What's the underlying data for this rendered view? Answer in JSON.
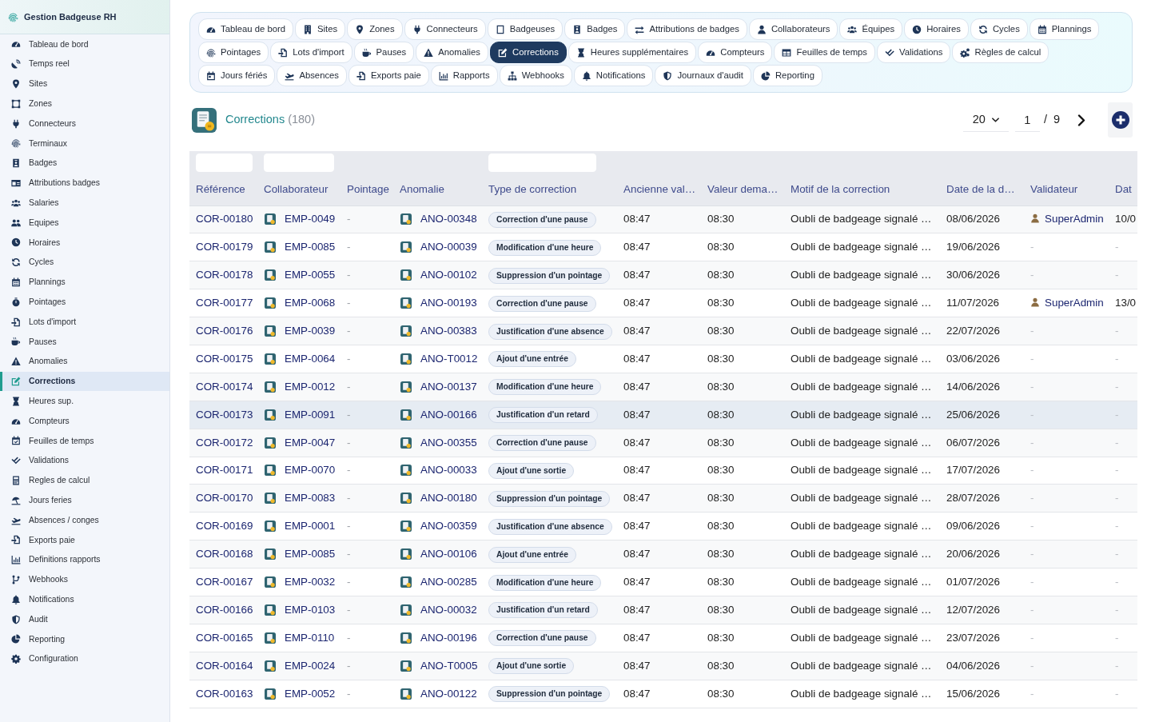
{
  "sidebar": {
    "title": "Gestion Badgeuse RH",
    "items": [
      {
        "label": "Tableau de bord",
        "selected": false
      },
      {
        "label": "Temps reel",
        "selected": false
      },
      {
        "label": "Sites",
        "selected": false
      },
      {
        "label": "Zones",
        "selected": false
      },
      {
        "label": "Connecteurs",
        "selected": false
      },
      {
        "label": "Terminaux",
        "selected": false
      },
      {
        "label": "Badges",
        "selected": false
      },
      {
        "label": "Attributions badges",
        "selected": false
      },
      {
        "label": "Salaries",
        "selected": false
      },
      {
        "label": "Equipes",
        "selected": false
      },
      {
        "label": "Horaires",
        "selected": false
      },
      {
        "label": "Cycles",
        "selected": false
      },
      {
        "label": "Plannings",
        "selected": false
      },
      {
        "label": "Pointages",
        "selected": false
      },
      {
        "label": "Lots d'import",
        "selected": false
      },
      {
        "label": "Pauses",
        "selected": false
      },
      {
        "label": "Anomalies",
        "selected": false
      },
      {
        "label": "Corrections",
        "selected": true
      },
      {
        "label": "Heures sup.",
        "selected": false
      },
      {
        "label": "Compteurs",
        "selected": false
      },
      {
        "label": "Feuilles de temps",
        "selected": false
      },
      {
        "label": "Validations",
        "selected": false
      },
      {
        "label": "Regles de calcul",
        "selected": false
      },
      {
        "label": "Jours feries",
        "selected": false
      },
      {
        "label": "Absences / conges",
        "selected": false
      },
      {
        "label": "Exports paie",
        "selected": false
      },
      {
        "label": "Definitions rapports",
        "selected": false
      },
      {
        "label": "Webhooks",
        "selected": false
      },
      {
        "label": "Notifications",
        "selected": false
      },
      {
        "label": "Audit",
        "selected": false
      },
      {
        "label": "Reporting",
        "selected": false
      },
      {
        "label": "Configuration",
        "selected": false
      }
    ]
  },
  "tab_rows": [
    [
      {
        "label": "Tableau de bord",
        "selected": false
      },
      {
        "label": "Sites",
        "selected": false
      },
      {
        "label": "Zones",
        "selected": false
      },
      {
        "label": "Connecteurs",
        "selected": false
      },
      {
        "label": "Badgeuses",
        "selected": false
      },
      {
        "label": "Badges",
        "selected": false
      },
      {
        "label": "Attributions de badges",
        "selected": false
      },
      {
        "label": "Collaborateurs",
        "selected": false
      },
      {
        "label": "Équipes",
        "selected": false
      },
      {
        "label": "Horaires",
        "selected": false
      },
      {
        "label": "Cycles",
        "selected": false
      },
      {
        "label": "Plannings",
        "selected": false
      }
    ],
    [
      {
        "label": "Pointages",
        "selected": false
      },
      {
        "label": "Lots d'import",
        "selected": false
      },
      {
        "label": "Pauses",
        "selected": false
      },
      {
        "label": "Anomalies",
        "selected": false
      },
      {
        "label": "Corrections",
        "selected": true
      },
      {
        "label": "Heures supplémentaires",
        "selected": false
      },
      {
        "label": "Compteurs",
        "selected": false
      },
      {
        "label": "Feuilles de temps",
        "selected": false
      },
      {
        "label": "Validations",
        "selected": false
      },
      {
        "label": "Règles de calcul",
        "selected": false
      }
    ],
    [
      {
        "label": "Jours fériés",
        "selected": false
      },
      {
        "label": "Absences",
        "selected": false
      },
      {
        "label": "Exports paie",
        "selected": false
      },
      {
        "label": "Rapports",
        "selected": false
      },
      {
        "label": "Webhooks",
        "selected": false
      },
      {
        "label": "Notifications",
        "selected": false
      },
      {
        "label": "Journaux d'audit",
        "selected": false
      },
      {
        "label": "Reporting",
        "selected": false
      }
    ]
  ],
  "header": {
    "title": "Corrections",
    "count": "(180)",
    "page_size": "20",
    "page": "1",
    "page_total": "/ 9"
  },
  "table": {
    "columns": [
      {
        "label": "Référence",
        "filter": true
      },
      {
        "label": "Collaborateur",
        "filter": true
      },
      {
        "label": "Pointage",
        "filter": false
      },
      {
        "label": "Anomalie",
        "filter": false
      },
      {
        "label": "Type de correction",
        "filter": true
      },
      {
        "label": "Ancienne val…",
        "filter": false
      },
      {
        "label": "Valeur dema…",
        "filter": false
      },
      {
        "label": "Motif de la correction",
        "filter": false
      },
      {
        "label": "Date de la d…",
        "filter": false
      },
      {
        "label": "Validateur",
        "filter": false
      },
      {
        "label": "Dat",
        "filter": false
      }
    ],
    "rows": [
      {
        "selected": false,
        "reference": "COR-00180",
        "employee": "EMP-0049",
        "clocking": "-",
        "anomaly": "ANO-00348",
        "correction_type": "Correction d'une pause",
        "old_value": "08:47",
        "requested_value": "08:30",
        "reason": "Oubli de badgeage signalé …",
        "request_date": "08/06/2026",
        "validator": {
          "kind": "user",
          "name": "SuperAdmin"
        },
        "column_11": {
          "kind": "value",
          "text": "10/0"
        }
      },
      {
        "selected": false,
        "reference": "COR-00179",
        "employee": "EMP-0085",
        "clocking": "-",
        "anomaly": "ANO-00039",
        "correction_type": "Modification d'une heure",
        "old_value": "08:47",
        "requested_value": "08:30",
        "reason": "Oubli de badgeage signalé …",
        "request_date": "19/06/2026",
        "validator": {
          "kind": "none",
          "name": "-"
        },
        "column_11": {
          "kind": "none",
          "text": "-"
        }
      },
      {
        "selected": false,
        "reference": "COR-00178",
        "employee": "EMP-0055",
        "clocking": "-",
        "anomaly": "ANO-00102",
        "correction_type": "Suppression d'un pointage",
        "old_value": "08:47",
        "requested_value": "08:30",
        "reason": "Oubli de badgeage signalé …",
        "request_date": "30/06/2026",
        "validator": {
          "kind": "none",
          "name": "-"
        },
        "column_11": {
          "kind": "none",
          "text": "-"
        }
      },
      {
        "selected": false,
        "reference": "COR-00177",
        "employee": "EMP-0068",
        "clocking": "-",
        "anomaly": "ANO-00193",
        "correction_type": "Correction d'une pause",
        "old_value": "08:47",
        "requested_value": "08:30",
        "reason": "Oubli de badgeage signalé …",
        "request_date": "11/07/2026",
        "validator": {
          "kind": "user",
          "name": "SuperAdmin"
        },
        "column_11": {
          "kind": "value",
          "text": "13/0"
        }
      },
      {
        "selected": false,
        "reference": "COR-00176",
        "employee": "EMP-0039",
        "clocking": "-",
        "anomaly": "ANO-00383",
        "correction_type": "Justification d'une absence",
        "old_value": "08:47",
        "requested_value": "08:30",
        "reason": "Oubli de badgeage signalé …",
        "request_date": "22/07/2026",
        "validator": {
          "kind": "none",
          "name": "-"
        },
        "column_11": {
          "kind": "none",
          "text": "-"
        }
      },
      {
        "selected": false,
        "reference": "COR-00175",
        "employee": "EMP-0064",
        "clocking": "-",
        "anomaly": "ANO-T0012",
        "correction_type": "Ajout d'une entrée",
        "old_value": "08:47",
        "requested_value": "08:30",
        "reason": "Oubli de badgeage signalé …",
        "request_date": "03/06/2026",
        "validator": {
          "kind": "none",
          "name": "-"
        },
        "column_11": {
          "kind": "none",
          "text": "-"
        }
      },
      {
        "selected": false,
        "reference": "COR-00174",
        "employee": "EMP-0012",
        "clocking": "-",
        "anomaly": "ANO-00137",
        "correction_type": "Modification d'une heure",
        "old_value": "08:47",
        "requested_value": "08:30",
        "reason": "Oubli de badgeage signalé …",
        "request_date": "14/06/2026",
        "validator": {
          "kind": "none",
          "name": "-"
        },
        "column_11": {
          "kind": "none",
          "text": "-"
        }
      },
      {
        "selected": true,
        "reference": "COR-00173",
        "employee": "EMP-0091",
        "clocking": "-",
        "anomaly": "ANO-00166",
        "correction_type": "Justification d'un retard",
        "old_value": "08:47",
        "requested_value": "08:30",
        "reason": "Oubli de badgeage signalé …",
        "request_date": "25/06/2026",
        "validator": {
          "kind": "none",
          "name": "-"
        },
        "column_11": {
          "kind": "none",
          "text": "-"
        }
      },
      {
        "selected": false,
        "reference": "COR-00172",
        "employee": "EMP-0047",
        "clocking": "-",
        "anomaly": "ANO-00355",
        "correction_type": "Correction d'une pause",
        "old_value": "08:47",
        "requested_value": "08:30",
        "reason": "Oubli de badgeage signalé …",
        "request_date": "06/07/2026",
        "validator": {
          "kind": "none",
          "name": "-"
        },
        "column_11": {
          "kind": "none",
          "text": "-"
        }
      },
      {
        "selected": false,
        "reference": "COR-00171",
        "employee": "EMP-0070",
        "clocking": "-",
        "anomaly": "ANO-00033",
        "correction_type": "Ajout d'une sortie",
        "old_value": "08:47",
        "requested_value": "08:30",
        "reason": "Oubli de badgeage signalé …",
        "request_date": "17/07/2026",
        "validator": {
          "kind": "none",
          "name": "-"
        },
        "column_11": {
          "kind": "none",
          "text": "-"
        }
      },
      {
        "selected": false,
        "reference": "COR-00170",
        "employee": "EMP-0083",
        "clocking": "-",
        "anomaly": "ANO-00180",
        "correction_type": "Suppression d'un pointage",
        "old_value": "08:47",
        "requested_value": "08:30",
        "reason": "Oubli de badgeage signalé …",
        "request_date": "28/07/2026",
        "validator": {
          "kind": "none",
          "name": "-"
        },
        "column_11": {
          "kind": "none",
          "text": "-"
        }
      },
      {
        "selected": false,
        "reference": "COR-00169",
        "employee": "EMP-0001",
        "clocking": "-",
        "anomaly": "ANO-00359",
        "correction_type": "Justification d'une absence",
        "old_value": "08:47",
        "requested_value": "08:30",
        "reason": "Oubli de badgeage signalé …",
        "request_date": "09/06/2026",
        "validator": {
          "kind": "none",
          "name": "-"
        },
        "column_11": {
          "kind": "none",
          "text": "-"
        }
      },
      {
        "selected": false,
        "reference": "COR-00168",
        "employee": "EMP-0085",
        "clocking": "-",
        "anomaly": "ANO-00106",
        "correction_type": "Ajout d'une entrée",
        "old_value": "08:47",
        "requested_value": "08:30",
        "reason": "Oubli de badgeage signalé …",
        "request_date": "20/06/2026",
        "validator": {
          "kind": "none",
          "name": "-"
        },
        "column_11": {
          "kind": "none",
          "text": "-"
        }
      },
      {
        "selected": false,
        "reference": "COR-00167",
        "employee": "EMP-0032",
        "clocking": "-",
        "anomaly": "ANO-00285",
        "correction_type": "Modification d'une heure",
        "old_value": "08:47",
        "requested_value": "08:30",
        "reason": "Oubli de badgeage signalé …",
        "request_date": "01/07/2026",
        "validator": {
          "kind": "none",
          "name": "-"
        },
        "column_11": {
          "kind": "none",
          "text": "-"
        }
      },
      {
        "selected": false,
        "reference": "COR-00166",
        "employee": "EMP-0103",
        "clocking": "-",
        "anomaly": "ANO-00032",
        "correction_type": "Justification d'un retard",
        "old_value": "08:47",
        "requested_value": "08:30",
        "reason": "Oubli de badgeage signalé …",
        "request_date": "12/07/2026",
        "validator": {
          "kind": "none",
          "name": "-"
        },
        "column_11": {
          "kind": "none",
          "text": "-"
        }
      },
      {
        "selected": false,
        "reference": "COR-00165",
        "employee": "EMP-0110",
        "clocking": "-",
        "anomaly": "ANO-00196",
        "correction_type": "Correction d'une pause",
        "old_value": "08:47",
        "requested_value": "08:30",
        "reason": "Oubli de badgeage signalé …",
        "request_date": "23/07/2026",
        "validator": {
          "kind": "none",
          "name": "-"
        },
        "column_11": {
          "kind": "none",
          "text": "-"
        }
      },
      {
        "selected": false,
        "reference": "COR-00164",
        "employee": "EMP-0024",
        "clocking": "-",
        "anomaly": "ANO-T0005",
        "correction_type": "Ajout d'une sortie",
        "old_value": "08:47",
        "requested_value": "08:30",
        "reason": "Oubli de badgeage signalé …",
        "request_date": "04/06/2026",
        "validator": {
          "kind": "none",
          "name": "-"
        },
        "column_11": {
          "kind": "none",
          "text": "-"
        }
      },
      {
        "selected": false,
        "reference": "COR-00163",
        "employee": "EMP-0052",
        "clocking": "-",
        "anomaly": "ANO-00122",
        "correction_type": "Suppression d'un pointage",
        "old_value": "08:47",
        "requested_value": "08:30",
        "reason": "Oubli de badgeage signalé …",
        "request_date": "15/06/2026",
        "validator": {
          "kind": "none",
          "name": "-"
        },
        "column_11": {
          "kind": "none",
          "text": "-"
        }
      }
    ]
  }
}
